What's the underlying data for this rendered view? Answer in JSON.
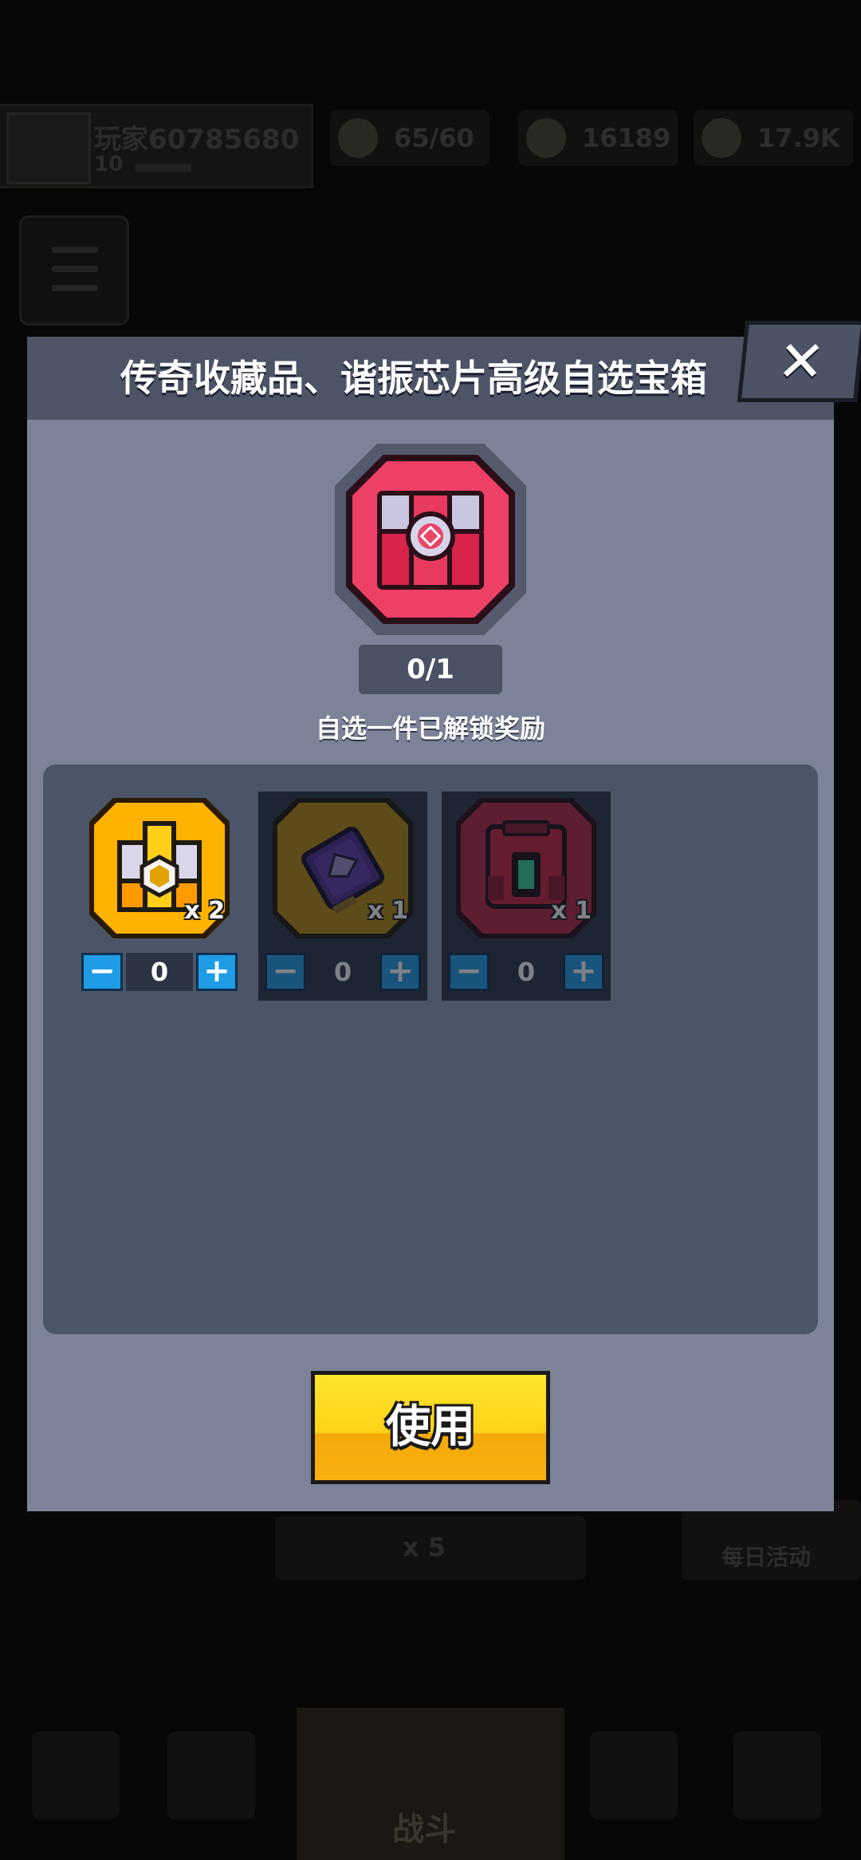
{
  "background": {
    "player_name": "玩家60785680",
    "player_level": "10",
    "resources": [
      {
        "icon": "energy-icon",
        "value": "65/60"
      },
      {
        "icon": "gem-icon",
        "value": "16189"
      },
      {
        "icon": "coin-icon",
        "value": "17.9K"
      }
    ],
    "bottom_pill_text": "x 5",
    "daily_label": "每日活动",
    "battle_label": "战斗"
  },
  "modal": {
    "title": "传奇收藏品、谐振芯片高级自选宝箱",
    "close_glyph": "✕",
    "progress": "0/1",
    "hint": "自选一件已解锁奖励",
    "items": [
      {
        "icon": "gold-chest-icon",
        "count": "x 2",
        "value": "0",
        "locked": false
      },
      {
        "icon": "resonance-chip-icon",
        "count": "x 1",
        "value": "0",
        "locked": true
      },
      {
        "icon": "red-collectible-chest-icon",
        "count": "x 1",
        "value": "0",
        "locked": true
      }
    ],
    "minus_glyph": "−",
    "plus_glyph": "+",
    "use_label": "使用"
  },
  "colors": {
    "modal_bg": "#7c8398",
    "modal_header": "#4c5466",
    "panel": "#4b5568",
    "use_button": "#ffd21a",
    "stepper_button": "#1f9ce6",
    "chest_red": "#ee3f66"
  }
}
